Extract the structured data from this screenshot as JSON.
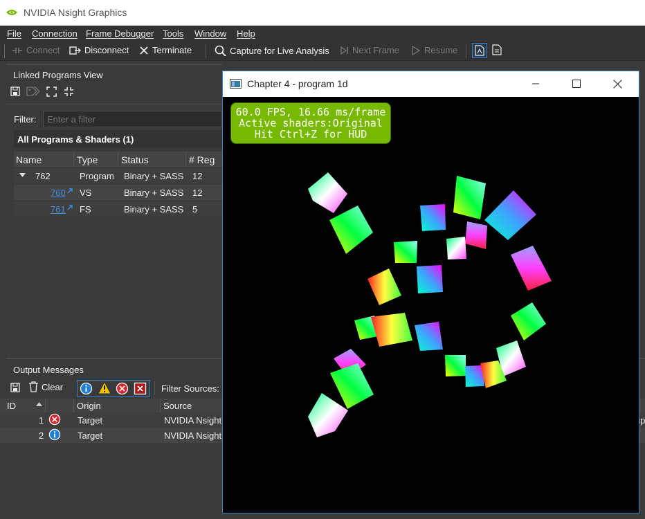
{
  "app": {
    "title": "NVIDIA Nsight Graphics"
  },
  "menu": [
    "File",
    "Connection",
    "Frame Debugger",
    "Tools",
    "Window",
    "Help"
  ],
  "toolbar": {
    "connect": "Connect",
    "disconnect": "Disconnect",
    "terminate": "Terminate",
    "capture": "Capture for Live Analysis",
    "next_frame": "Next Frame",
    "resume": "Resume"
  },
  "linked_programs": {
    "title": "Linked Programs View",
    "filter_label": "Filter:",
    "filter_placeholder": "Enter a filter",
    "section": "All Programs & Shaders (1)",
    "columns": [
      "Name",
      "Type",
      "Status",
      "# Reg"
    ],
    "rows": [
      {
        "name": "762",
        "type": "Program",
        "status": "Binary + SASS",
        "reg": "12"
      },
      {
        "name": "760",
        "type": "VS",
        "status": "Binary + SASS",
        "reg": "12"
      },
      {
        "name": "761",
        "type": "FS",
        "status": "Binary + SASS",
        "reg": "5"
      }
    ]
  },
  "output": {
    "title": "Output Messages",
    "clear": "Clear",
    "filter_sources": "Filter Sources:",
    "columns": [
      "ID",
      "Origin",
      "Source"
    ],
    "rows": [
      {
        "id": "1",
        "level": "error",
        "origin": "Target",
        "source": "NVIDIA Nsight"
      },
      {
        "id": "2",
        "level": "info",
        "origin": "Target",
        "source": "NVIDIA Nsight"
      }
    ],
    "overflow_text": "up"
  },
  "app_window": {
    "title": "Chapter 4 - program 1d",
    "hud": {
      "line1": "60.0 FPS, 16.66 ms/frame",
      "line2": "Active shaders:Original",
      "line3": "Hit Ctrl+Z for HUD"
    }
  },
  "colors": {
    "nvidia_green": "#76b900",
    "link_blue": "#3d8ee0",
    "error_red": "#d9262b",
    "info_blue": "#1e7fd6",
    "warning_yellow": "#f2c200",
    "window_border": "#3a82c7"
  }
}
